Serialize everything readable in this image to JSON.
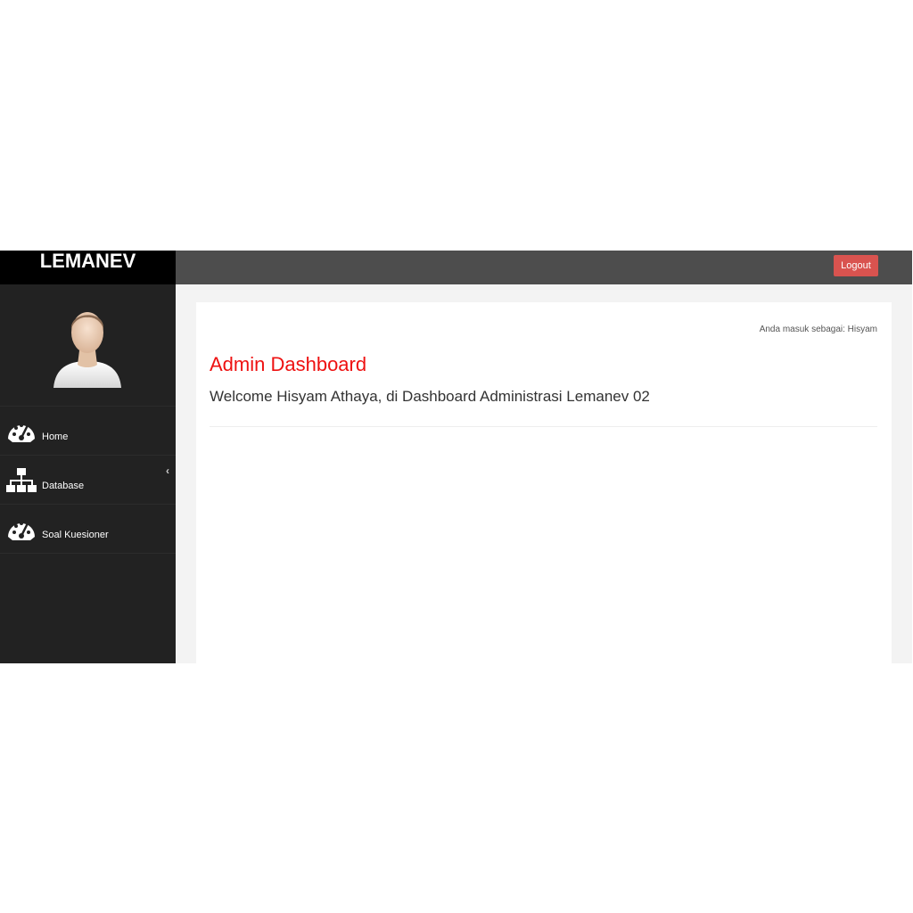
{
  "brand": {
    "title": "LEMANEV"
  },
  "header": {
    "logout_label": "Logout"
  },
  "sidebar": {
    "avatar_icon": "user-avatar",
    "items": [
      {
        "label": "Home",
        "icon": "dashboard-gauge-icon"
      },
      {
        "label": "Database",
        "icon": "sitemap-icon",
        "chevron": "‹"
      },
      {
        "label": "Soal Kuesioner",
        "icon": "dashboard-gauge-icon"
      }
    ]
  },
  "main": {
    "login_info": "Anda masuk sebagai: Hisyam",
    "title": "Admin Dashboard",
    "welcome": "Welcome Hisyam Athaya, di Dashboard Administrasi Lemanev 02"
  },
  "colors": {
    "accent": "#ee1111",
    "logout": "#d9534f",
    "sidebar": "#222222",
    "topbar": "#4d4d4d"
  }
}
